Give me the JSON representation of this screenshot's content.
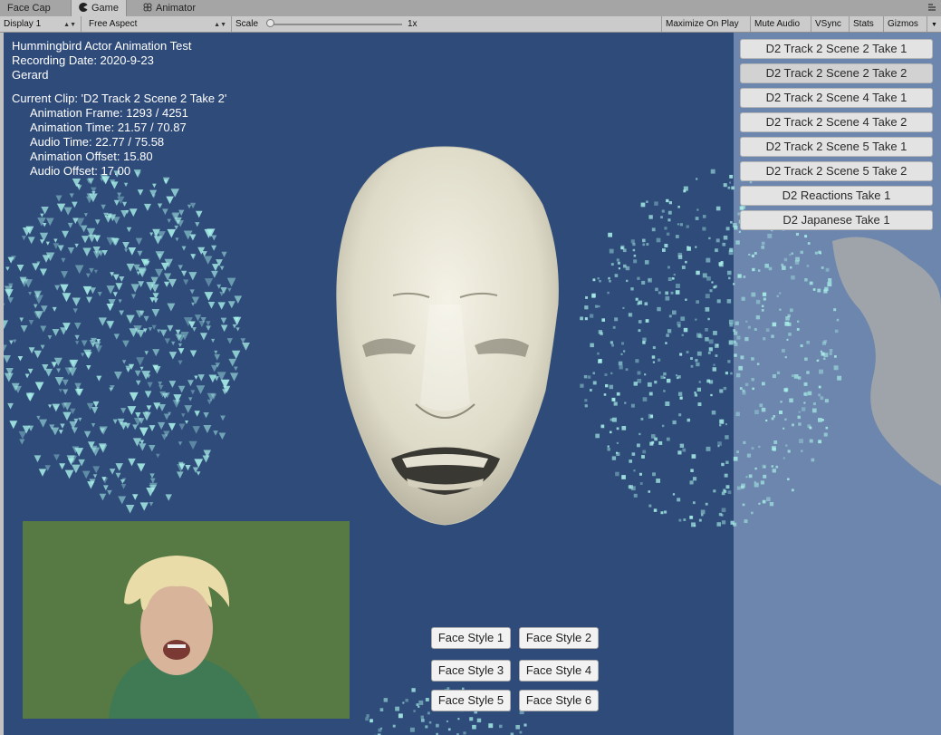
{
  "tabs": [
    {
      "label": "Face Cap",
      "icon": "none"
    },
    {
      "label": "Game",
      "icon": "pacman-icon"
    },
    {
      "label": "Animator",
      "icon": "animator-icon"
    }
  ],
  "toolbar": {
    "display": "Display 1",
    "aspect": "Free Aspect",
    "scale_label": "Scale",
    "scale_value": "1x",
    "maximize": "Maximize On Play",
    "mute": "Mute Audio",
    "vsync": "VSync",
    "stats": "Stats",
    "gizmos": "Gizmos"
  },
  "info": {
    "title": "Hummingbird Actor Animation Test",
    "recording_date": "Recording Date: 2020-9-23",
    "actor": "Gerard",
    "current_clip": "Current Clip: 'D2 Track 2 Scene 2 Take 2'",
    "animation_frame": "Animation Frame: 1293 / 4251",
    "animation_time": "Animation Time: 21.57 / 70.87",
    "audio_time": "Audio Time: 22.77 / 75.58",
    "animation_offset": "Animation Offset: 15.80",
    "audio_offset": "Audio Offset: 17.00"
  },
  "clips": [
    "D2 Track 2 Scene 2 Take 1",
    "D2 Track 2 Scene 2 Take 2",
    "D2 Track 2 Scene 4 Take 1",
    "D2 Track 2 Scene 4 Take 2",
    "D2 Track 2 Scene 5 Take 1",
    "D2 Track 2 Scene 5 Take 2",
    "D2 Reactions Take 1",
    "D2 Japanese Take 1"
  ],
  "selected_clip_index": 1,
  "face_styles": [
    "Face Style 1",
    "Face Style 2",
    "Face Style 3",
    "Face Style 4",
    "Face Style 5",
    "Face Style 6"
  ],
  "colors": {
    "viewport_bg": "#2f4b7a",
    "right_pane": "#6d86ad",
    "point_cloud": "#a8f0e8",
    "face_mesh": "#e6e4d6"
  }
}
